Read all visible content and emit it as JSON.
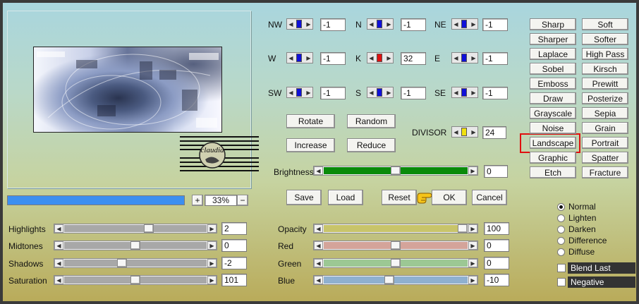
{
  "matrix": {
    "rows": [
      [
        {
          "label": "NW",
          "value": "-1"
        },
        {
          "label": "N",
          "value": "-1"
        },
        {
          "label": "NE",
          "value": "-1"
        }
      ],
      [
        {
          "label": "W",
          "value": "-1"
        },
        {
          "label": "K",
          "value": "32"
        },
        {
          "label": "E",
          "value": "-1"
        }
      ],
      [
        {
          "label": "SW",
          "value": "-1"
        },
        {
          "label": "S",
          "value": "-1"
        },
        {
          "label": "SE",
          "value": "-1"
        }
      ]
    ]
  },
  "zoom": {
    "value": "33%",
    "plus": "+",
    "minus": "−"
  },
  "actions": {
    "rotate": "Rotate",
    "random": "Random",
    "increase": "Increase",
    "reduce": "Reduce"
  },
  "divisor": {
    "label": "DIVISOR",
    "value": "24"
  },
  "brightness": {
    "label": "Brightness",
    "value": "0",
    "level": 0.5
  },
  "buttons": {
    "save": "Save",
    "load": "Load",
    "reset": "Reset",
    "ok": "OK",
    "cancel": "Cancel"
  },
  "left_sliders": [
    {
      "label": "Highlights",
      "value": "2",
      "level": 0.6
    },
    {
      "label": "Midtones",
      "value": "0",
      "level": 0.5
    },
    {
      "label": "Shadows",
      "value": "-2",
      "level": 0.4
    },
    {
      "label": "Saturation",
      "value": "101",
      "level": 0.5
    }
  ],
  "color_sliders": [
    {
      "label": "Opacity",
      "value": "100",
      "level": 1.0,
      "color": "#c8c46a"
    },
    {
      "label": "Red",
      "value": "0",
      "level": 0.5,
      "color": "#d4a49a"
    },
    {
      "label": "Green",
      "value": "0",
      "level": 0.5,
      "color": "#9cc894"
    },
    {
      "label": "Blue",
      "value": "-10",
      "level": 0.45,
      "color": "#8fb0d0"
    }
  ],
  "presets": [
    [
      "Sharp",
      "Soft"
    ],
    [
      "Sharper",
      "Softer"
    ],
    [
      "Laplace",
      "High Pass"
    ],
    [
      "Sobel",
      "Kirsch"
    ],
    [
      "Emboss",
      "Prewitt"
    ],
    [
      "Draw",
      "Posterize"
    ],
    [
      "Grayscale",
      "Sepia"
    ],
    [
      "Noise",
      "Grain"
    ],
    [
      "Landscape",
      "Portrait"
    ],
    [
      "Graphic",
      "Spatter"
    ],
    [
      "Etch",
      "Fracture"
    ]
  ],
  "blend_modes": [
    {
      "label": "Normal",
      "selected": true
    },
    {
      "label": "Lighten",
      "selected": false
    },
    {
      "label": "Darken",
      "selected": false
    },
    {
      "label": "Difference",
      "selected": false
    },
    {
      "label": "Diffuse",
      "selected": false
    }
  ],
  "checks": [
    {
      "label": "Blend Last",
      "checked": false
    },
    {
      "label": "Negative",
      "checked": false
    }
  ],
  "watermark": {
    "text": "claudia"
  },
  "colors": {
    "highlight": "#e01010",
    "progress": "#3c8ff0",
    "brightness_track": "#0a8a0a",
    "spin_blue": "#1010d8",
    "spin_red": "#e01010",
    "spin_yellow": "#f0e010"
  }
}
